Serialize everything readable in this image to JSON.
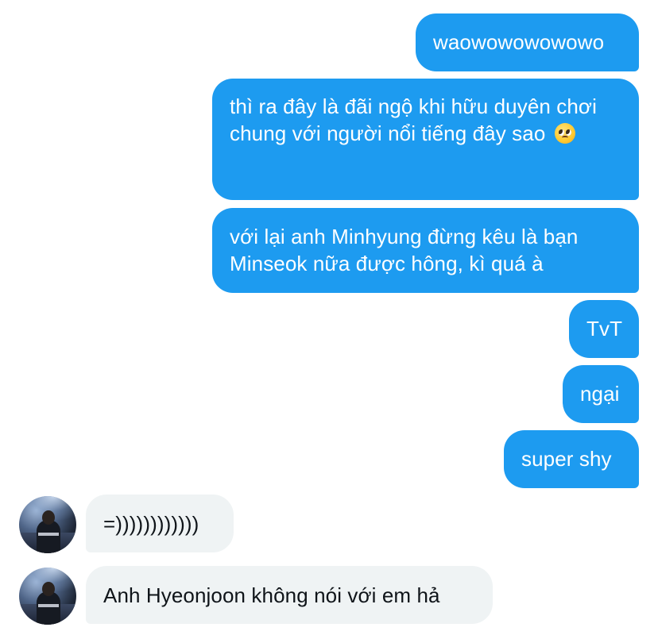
{
  "messages": [
    {
      "sender": "me",
      "text": "waowowowowowo"
    },
    {
      "sender": "me",
      "text": "thì ra đây là đãi ngộ khi hữu duyên chơi chung với người nổi tiếng đây sao",
      "emoji": "pleading-face-emoji"
    },
    {
      "sender": "me",
      "text": "với lại anh Minhyung đừng kêu là bạn Minseok nữa được hông, kì quá à"
    },
    {
      "sender": "me",
      "text": "TvT"
    },
    {
      "sender": "me",
      "text": "ngại"
    },
    {
      "sender": "me",
      "text": "super shy"
    },
    {
      "sender": "them",
      "text": "=))))))))))))"
    },
    {
      "sender": "them",
      "text": "Anh Hyeonjoon không nói với em hả"
    }
  ],
  "colors": {
    "outgoing_bubble": "#1d9bf0",
    "incoming_bubble": "#eff3f4",
    "outgoing_text": "#ffffff",
    "incoming_text": "#0f1419"
  }
}
